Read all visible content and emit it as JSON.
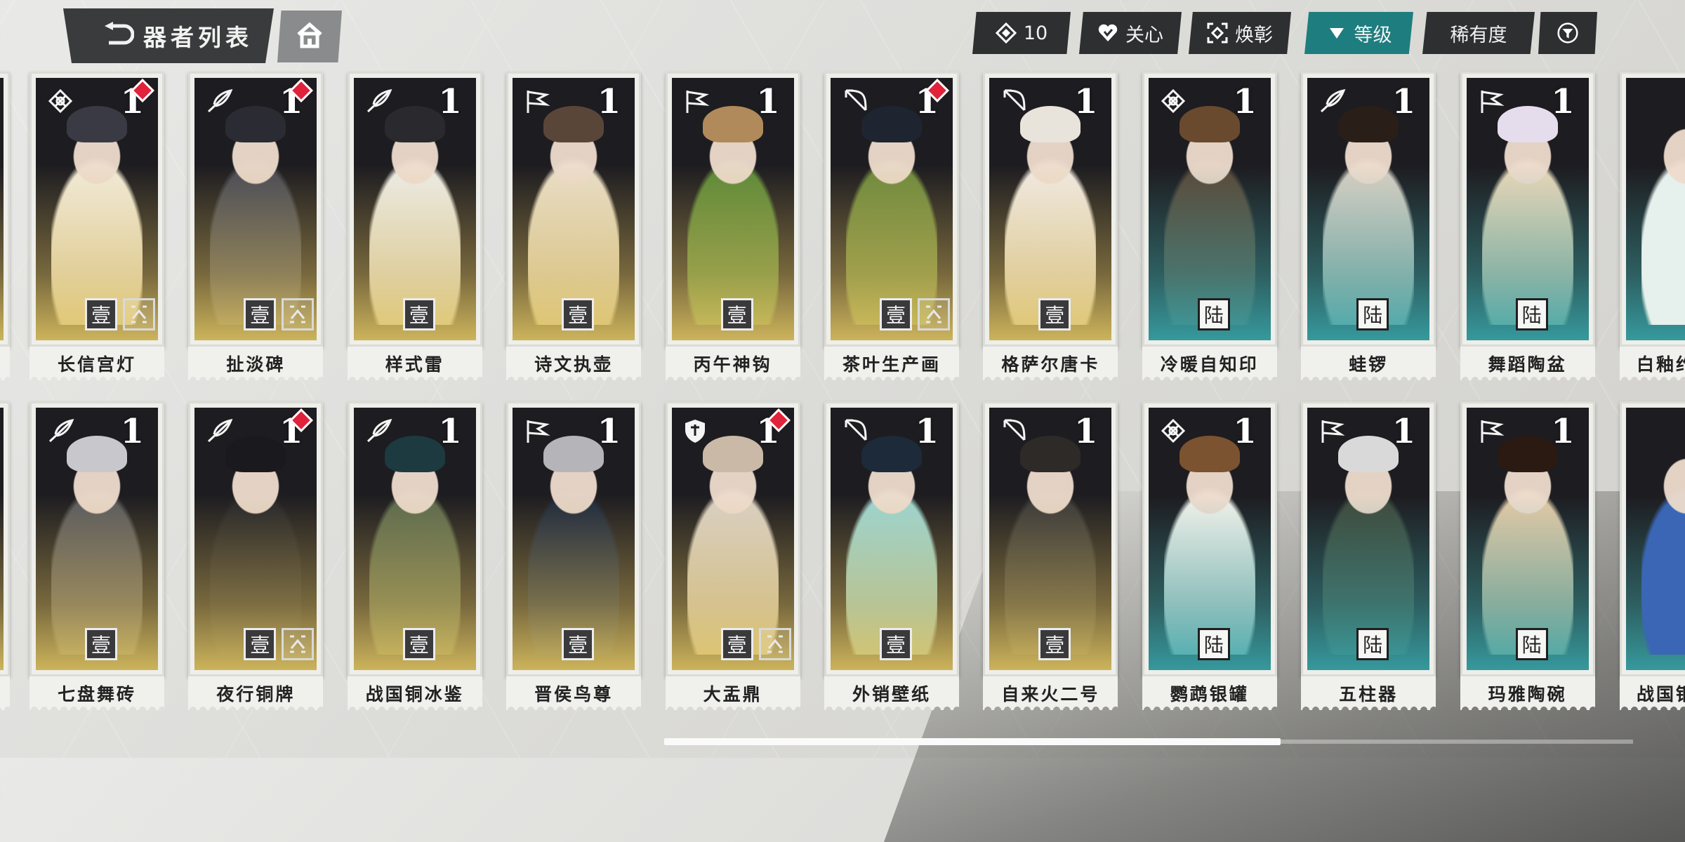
{
  "header": {
    "title": "器者列表",
    "back_icon": "back-arrow-icon",
    "home_icon": "home-icon"
  },
  "filters": [
    {
      "icon": "diamond-icon",
      "label": "10",
      "active": false
    },
    {
      "icon": "heart-icon",
      "label": "关心",
      "active": false
    },
    {
      "icon": "frame-icon",
      "label": "焕彰",
      "active": false
    },
    {
      "icon": "triangle-down-icon",
      "label": "等级",
      "active": true
    },
    {
      "icon": "",
      "label": "稀有度",
      "active": false
    },
    {
      "icon": "filter-icon",
      "label": "",
      "active": false
    }
  ],
  "colors": {
    "active_chip": "#1e7d7f",
    "chip": "#2e2f31",
    "gold_glow": "#dfc462",
    "teal_glow": "#38a6aa",
    "badge_red": "#e0223b"
  },
  "cards": [
    {
      "name": "长信宫灯",
      "level": "1",
      "rank": "壹",
      "upgrade": true,
      "new": true,
      "tier": "gold",
      "type": "knot"
    },
    {
      "name": "扯淡碑",
      "level": "1",
      "rank": "壹",
      "upgrade": true,
      "new": true,
      "tier": "gold",
      "type": "feather"
    },
    {
      "name": "样式雷",
      "level": "1",
      "rank": "壹",
      "upgrade": false,
      "new": false,
      "tier": "gold",
      "type": "feather"
    },
    {
      "name": "诗文执壶",
      "level": "1",
      "rank": "壹",
      "upgrade": false,
      "new": false,
      "tier": "gold",
      "type": "flag"
    },
    {
      "name": "丙午神钩",
      "level": "1",
      "rank": "壹",
      "upgrade": false,
      "new": false,
      "tier": "gold",
      "type": "flag"
    },
    {
      "name": "茶叶生产画",
      "level": "1",
      "rank": "壹",
      "upgrade": true,
      "new": true,
      "tier": "gold",
      "type": "bow"
    },
    {
      "name": "格萨尔唐卡",
      "level": "1",
      "rank": "壹",
      "upgrade": false,
      "new": false,
      "tier": "gold",
      "type": "bow"
    },
    {
      "name": "冷暖自知印",
      "level": "1",
      "rank": "陆",
      "upgrade": false,
      "new": false,
      "tier": "teal",
      "type": "knot"
    },
    {
      "name": "蛙锣",
      "level": "1",
      "rank": "陆",
      "upgrade": false,
      "new": false,
      "tier": "teal",
      "type": "feather"
    },
    {
      "name": "舞蹈陶盆",
      "level": "1",
      "rank": "陆",
      "upgrade": false,
      "new": false,
      "tier": "teal",
      "type": "flag"
    },
    {
      "name": "七盘舞砖",
      "level": "1",
      "rank": "壹",
      "upgrade": false,
      "new": false,
      "tier": "gold",
      "type": "feather"
    },
    {
      "name": "夜行铜牌",
      "level": "1",
      "rank": "壹",
      "upgrade": true,
      "new": true,
      "tier": "gold",
      "type": "feather"
    },
    {
      "name": "战国铜冰鉴",
      "level": "1",
      "rank": "壹",
      "upgrade": false,
      "new": false,
      "tier": "gold",
      "type": "feather"
    },
    {
      "name": "晋侯鸟尊",
      "level": "1",
      "rank": "壹",
      "upgrade": false,
      "new": false,
      "tier": "gold",
      "type": "flag"
    },
    {
      "name": "大盂鼎",
      "level": "1",
      "rank": "壹",
      "upgrade": true,
      "new": true,
      "tier": "gold",
      "type": "shield"
    },
    {
      "name": "外销壁纸",
      "level": "1",
      "rank": "壹",
      "upgrade": false,
      "new": false,
      "tier": "gold",
      "type": "bow"
    },
    {
      "name": "自来火二号",
      "level": "1",
      "rank": "壹",
      "upgrade": false,
      "new": false,
      "tier": "gold",
      "type": "bow"
    },
    {
      "name": "鹦鹉银罐",
      "level": "1",
      "rank": "陆",
      "upgrade": false,
      "new": false,
      "tier": "teal",
      "type": "knot"
    },
    {
      "name": "五柱器",
      "level": "1",
      "rank": "陆",
      "upgrade": false,
      "new": false,
      "tier": "teal",
      "type": "flag"
    },
    {
      "name": "玛雅陶碗",
      "level": "1",
      "rank": "陆",
      "upgrade": false,
      "new": false,
      "tier": "teal",
      "type": "flag"
    }
  ],
  "partial_cards": {
    "right_top": "白釉约",
    "right_bottom": "战国铜"
  },
  "scroll": {
    "position_fraction": 0.64
  }
}
